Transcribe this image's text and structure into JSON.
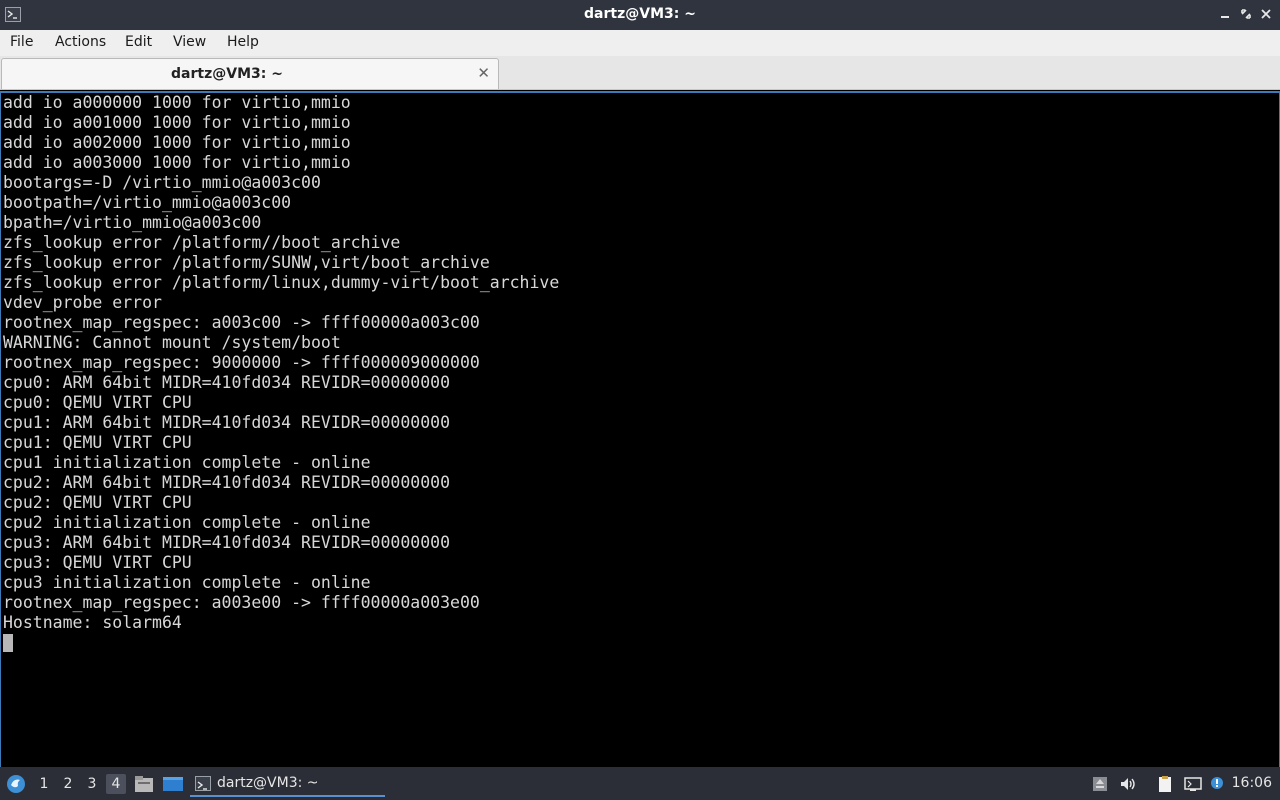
{
  "window": {
    "title": "dartz@VM3: ~"
  },
  "menu": [
    "File",
    "Actions",
    "Edit",
    "View",
    "Help"
  ],
  "tab": {
    "label": "dartz@VM3: ~"
  },
  "terminal": {
    "lines": [
      "add io a000000 1000 for virtio,mmio",
      "add io a001000 1000 for virtio,mmio",
      "add io a002000 1000 for virtio,mmio",
      "add io a003000 1000 for virtio,mmio",
      "bootargs=-D /virtio_mmio@a003c00",
      "bootpath=/virtio_mmio@a003c00",
      "bpath=/virtio_mmio@a003c00",
      "zfs_lookup error /platform//boot_archive",
      "zfs_lookup error /platform/SUNW,virt/boot_archive",
      "zfs_lookup error /platform/linux,dummy-virt/boot_archive",
      "vdev_probe error",
      "rootnex_map_regspec: a003c00 -> ffff00000a003c00",
      "WARNING: Cannot mount /system/boot",
      "rootnex_map_regspec: 9000000 -> ffff000009000000",
      "cpu0: ARM 64bit MIDR=410fd034 REVIDR=00000000",
      "cpu0: QEMU VIRT CPU",
      "cpu1: ARM 64bit MIDR=410fd034 REVIDR=00000000",
      "cpu1: QEMU VIRT CPU",
      "cpu1 initialization complete - online",
      "cpu2: ARM 64bit MIDR=410fd034 REVIDR=00000000",
      "cpu2: QEMU VIRT CPU",
      "cpu2 initialization complete - online",
      "cpu3: ARM 64bit MIDR=410fd034 REVIDR=00000000",
      "cpu3: QEMU VIRT CPU",
      "cpu3 initialization complete - online",
      "rootnex_map_regspec: a003e00 -> ffff00000a003e00",
      "Hostname: solarm64"
    ]
  },
  "taskbar": {
    "workspaces": [
      "1",
      "2",
      "3",
      "4"
    ],
    "active_workspace": "4",
    "task_label": "dartz@VM3: ~",
    "clock": "16:06"
  },
  "colors": {
    "titlebar": "#2f343f",
    "taskbar": "#2b2e37",
    "terminal_bg": "#000000",
    "accent": "#3d7ab8"
  },
  "icons": [
    "terminal-icon",
    "minimize-icon",
    "maximize-icon",
    "close-icon",
    "start-menu-icon",
    "file-manager-icon",
    "show-desktop-icon",
    "upload-icon",
    "volume-icon",
    "clipboard-icon",
    "network-icon",
    "updates-icon"
  ]
}
